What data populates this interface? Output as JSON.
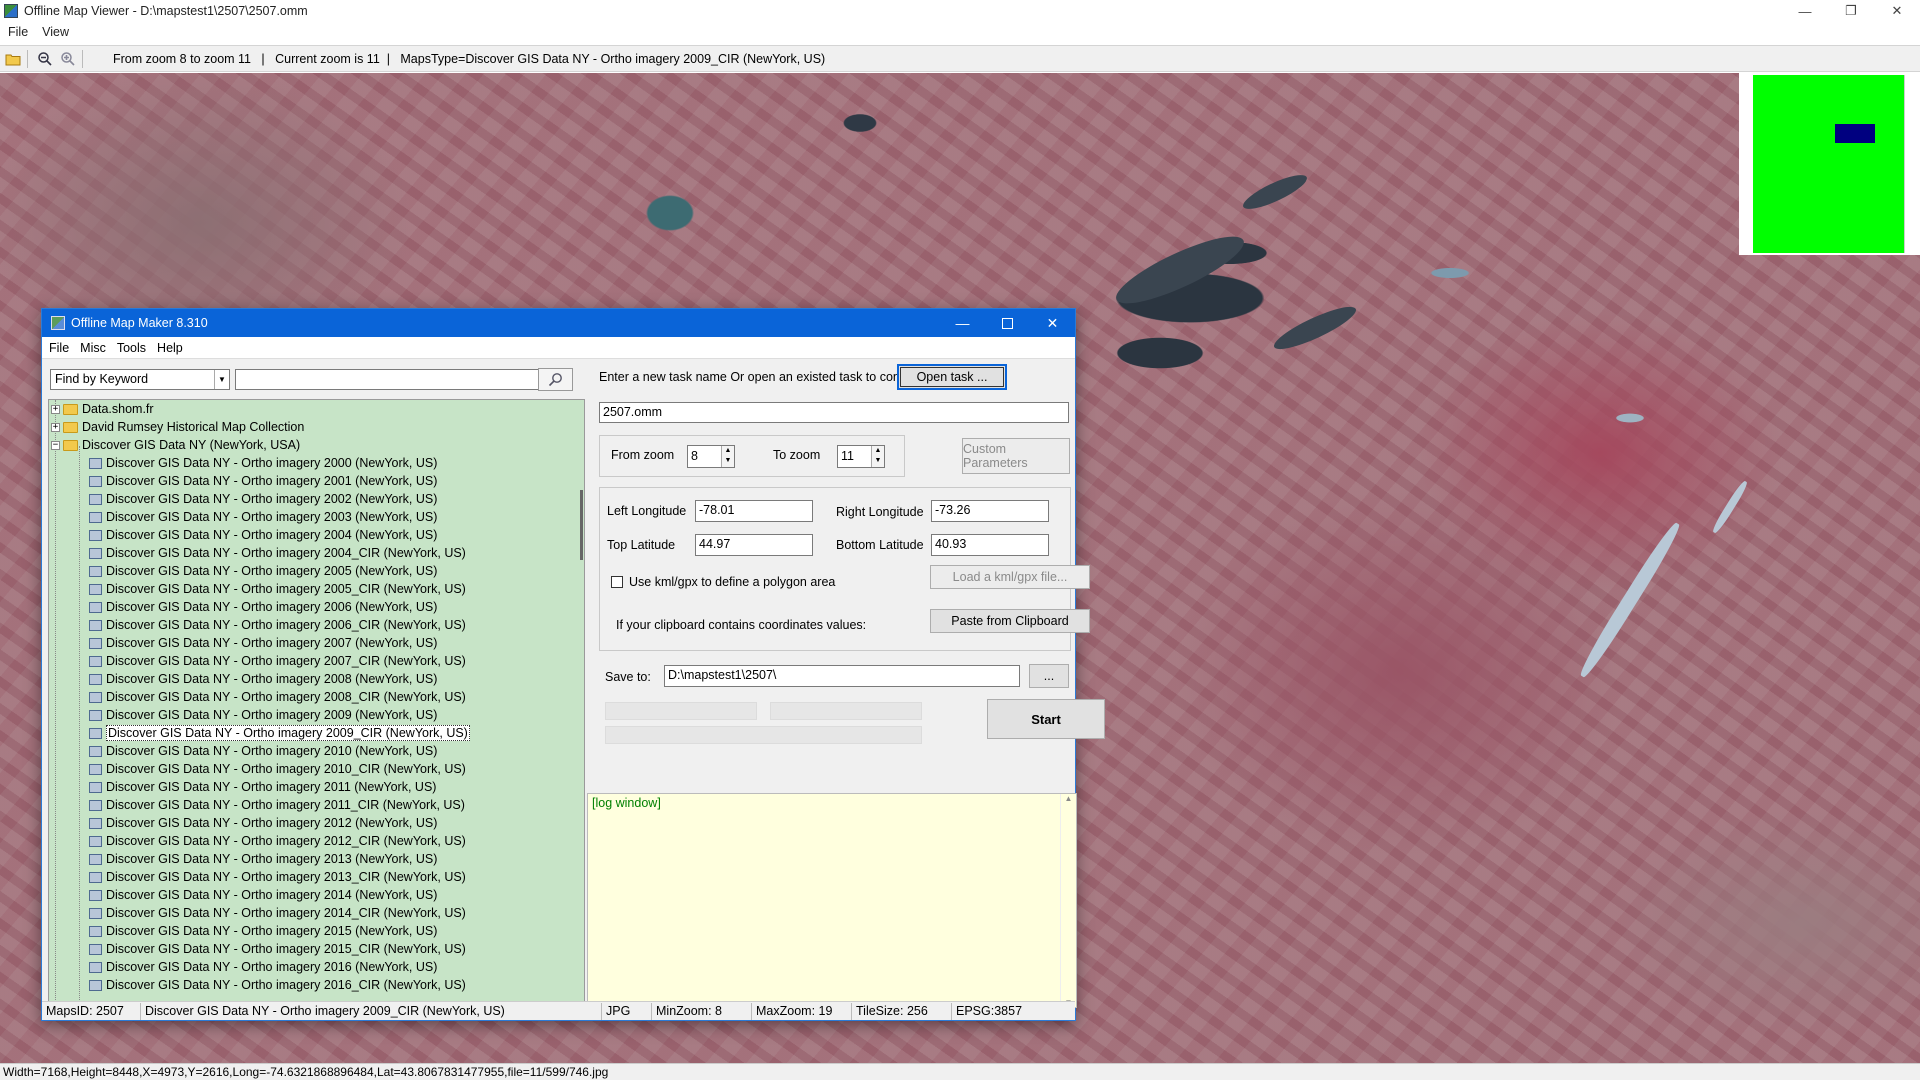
{
  "viewer": {
    "title": "Offline Map Viewer - D:\\mapstest1\\2507\\2507.omm",
    "menu": [
      "File",
      "View"
    ],
    "toolbar_info": "From zoom 8 to zoom 11   |   Current zoom is 11  |   MapsType=Discover GIS Data NY - Ortho imagery 2009_CIR (NewYork, US)",
    "status": "Width=7168,Height=8448,X=4973,Y=2616,Long=-74.6321868896484,Lat=43.8067831477955,file=11/599/746.jpg",
    "window_controls": [
      "—",
      "❐",
      "✕"
    ]
  },
  "dialog": {
    "title": "Offline Map Maker 8.310",
    "menu": [
      "File",
      "Misc",
      "Tools",
      "Help"
    ],
    "search_mode": "Find by Keyword",
    "search_value": "",
    "tree": [
      {
        "label": "Data.shom.fr",
        "type": "folder",
        "exp": "+"
      },
      {
        "label": "David Rumsey Historical Map Collection",
        "type": "folder",
        "exp": "+"
      },
      {
        "label": "Discover GIS Data NY (NewYork, USA)",
        "type": "folder-open",
        "exp": "−"
      },
      {
        "label": "Discover GIS Data NY - Ortho imagery 2000 (NewYork, US)",
        "type": "map"
      },
      {
        "label": "Discover GIS Data NY - Ortho imagery 2001 (NewYork, US)",
        "type": "map"
      },
      {
        "label": "Discover GIS Data NY - Ortho imagery 2002 (NewYork, US)",
        "type": "map"
      },
      {
        "label": "Discover GIS Data NY - Ortho imagery 2003 (NewYork, US)",
        "type": "map"
      },
      {
        "label": "Discover GIS Data NY - Ortho imagery 2004 (NewYork, US)",
        "type": "map"
      },
      {
        "label": "Discover GIS Data NY - Ortho imagery 2004_CIR (NewYork, US)",
        "type": "map"
      },
      {
        "label": "Discover GIS Data NY - Ortho imagery 2005 (NewYork, US)",
        "type": "map"
      },
      {
        "label": "Discover GIS Data NY - Ortho imagery 2005_CIR (NewYork, US)",
        "type": "map"
      },
      {
        "label": "Discover GIS Data NY - Ortho imagery 2006 (NewYork, US)",
        "type": "map"
      },
      {
        "label": "Discover GIS Data NY - Ortho imagery 2006_CIR (NewYork, US)",
        "type": "map"
      },
      {
        "label": "Discover GIS Data NY - Ortho imagery 2007 (NewYork, US)",
        "type": "map"
      },
      {
        "label": "Discover GIS Data NY - Ortho imagery 2007_CIR (NewYork, US)",
        "type": "map"
      },
      {
        "label": "Discover GIS Data NY - Ortho imagery 2008 (NewYork, US)",
        "type": "map"
      },
      {
        "label": "Discover GIS Data NY - Ortho imagery 2008_CIR (NewYork, US)",
        "type": "map"
      },
      {
        "label": "Discover GIS Data NY - Ortho imagery 2009 (NewYork, US)",
        "type": "map"
      },
      {
        "label": "Discover GIS Data NY - Ortho imagery 2009_CIR (NewYork, US)",
        "type": "map",
        "selected": true
      },
      {
        "label": "Discover GIS Data NY - Ortho imagery 2010 (NewYork, US)",
        "type": "map"
      },
      {
        "label": "Discover GIS Data NY - Ortho imagery 2010_CIR (NewYork, US)",
        "type": "map"
      },
      {
        "label": "Discover GIS Data NY - Ortho imagery 2011 (NewYork, US)",
        "type": "map"
      },
      {
        "label": "Discover GIS Data NY - Ortho imagery 2011_CIR (NewYork, US)",
        "type": "map"
      },
      {
        "label": "Discover GIS Data NY - Ortho imagery 2012 (NewYork, US)",
        "type": "map"
      },
      {
        "label": "Discover GIS Data NY - Ortho imagery 2012_CIR (NewYork, US)",
        "type": "map"
      },
      {
        "label": "Discover GIS Data NY - Ortho imagery 2013 (NewYork, US)",
        "type": "map"
      },
      {
        "label": "Discover GIS Data NY - Ortho imagery 2013_CIR (NewYork, US)",
        "type": "map"
      },
      {
        "label": "Discover GIS Data NY - Ortho imagery 2014 (NewYork, US)",
        "type": "map"
      },
      {
        "label": "Discover GIS Data NY - Ortho imagery 2014_CIR (NewYork, US)",
        "type": "map"
      },
      {
        "label": "Discover GIS Data NY - Ortho imagery 2015 (NewYork, US)",
        "type": "map"
      },
      {
        "label": "Discover GIS Data NY - Ortho imagery 2015_CIR (NewYork, US)",
        "type": "map"
      },
      {
        "label": "Discover GIS Data NY - Ortho imagery 2016 (NewYork, US)",
        "type": "map"
      },
      {
        "label": "Discover GIS Data NY - Ortho imagery 2016_CIR (NewYork, US)",
        "type": "map"
      }
    ],
    "task": {
      "prompt": "Enter a new task name Or open an existed task to continue:",
      "open_button": "Open task ...",
      "task_name": "2507.omm"
    },
    "zoom": {
      "from_label": "From zoom",
      "from_value": "8",
      "to_label": "To zoom",
      "to_value": "11",
      "custom_button": "Custom Parameters"
    },
    "coords": {
      "left_label": "Left Longitude",
      "left_value": "-78.01",
      "right_label": "Right Longitude",
      "right_value": "-73.26",
      "top_label": "Top Latitude",
      "top_value": "44.97",
      "bottom_label": "Bottom Latitude",
      "bottom_value": "40.93",
      "kml_label": "Use kml/gpx to define a polygon area",
      "kml_button": "Load a kml/gpx file...",
      "clipboard_label": "If your clipboard contains coordinates values:",
      "clipboard_button": "Paste from Clipboard"
    },
    "save": {
      "label": "Save to:",
      "path": "D:\\mapstest1\\2507\\",
      "browse": "...",
      "start": "Start"
    },
    "log": "[log window]",
    "status": {
      "maps_id": "MapsID: 2507",
      "name": "Discover GIS Data NY - Ortho imagery 2009_CIR (NewYork, US)",
      "format": "JPG",
      "min_zoom": "MinZoom: 8",
      "max_zoom": "MaxZoom: 19",
      "tile_size": "TileSize: 256",
      "epsg": "EPSG:3857"
    }
  },
  "colors": {
    "overview_bg": "#00ff00",
    "overview_view": "#000080",
    "tree_bg": "#c7e4c7",
    "dialog_title": "#0a64d8",
    "log_bg": "#ffffde"
  }
}
